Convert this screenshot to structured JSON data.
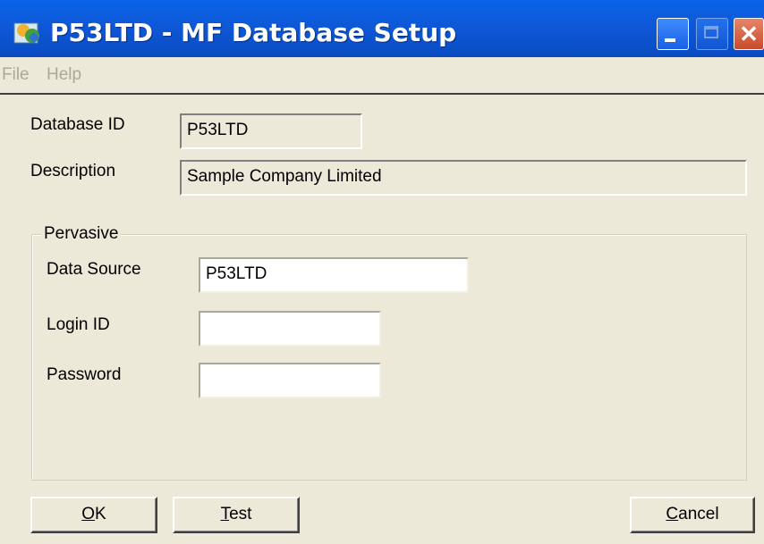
{
  "window": {
    "title": "P53LTD - MF Database Setup",
    "titlebar_color": "#0a5ad8",
    "buttons": {
      "minimize": "minimize",
      "maximize": "maximize",
      "close": "✕"
    }
  },
  "menu": {
    "items": [
      "File",
      "Help"
    ]
  },
  "form": {
    "database_id": {
      "label": "Database ID",
      "value": "P53LTD"
    },
    "description": {
      "label": "Description",
      "value": "Sample Company Limited"
    }
  },
  "group": {
    "title": "Pervasive",
    "data_source": {
      "label": "Data Source",
      "value": "P53LTD"
    },
    "login_id": {
      "label": "Login ID",
      "value": ""
    },
    "password": {
      "label": "Password",
      "value": ""
    }
  },
  "buttons": {
    "ok": {
      "mnemonic": "O",
      "rest": "K"
    },
    "test": {
      "mnemonic": "T",
      "rest": "est"
    },
    "cancel": {
      "mnemonic": "C",
      "rest": "ancel"
    }
  }
}
